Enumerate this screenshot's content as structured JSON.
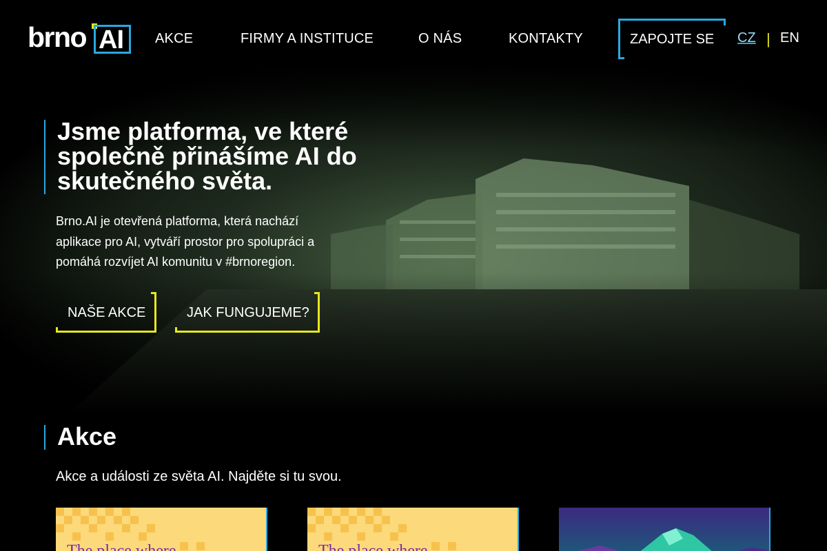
{
  "header": {
    "logo": {
      "text": "brno",
      "boxed_text": "AI",
      "alt": "brno.AI"
    },
    "nav": [
      {
        "label": "AKCE"
      },
      {
        "label": "FIRMY A INSTITUCE"
      },
      {
        "label": "O NÁS"
      },
      {
        "label": "KONTAKTY"
      }
    ],
    "cta_label": "ZAPOJTE SE",
    "languages": [
      {
        "label": "CZ",
        "active": true
      },
      {
        "label": "EN",
        "active": false
      }
    ],
    "lang_separator": "|"
  },
  "hero": {
    "title": "Jsme platforma, ve které společně přinášíme AI do skutečného světa.",
    "lead": "Brno.AI je otevřená platforma, která nachází aplikace pro AI, vytváří prostor pro spolupráci a pomáhá rozvíjet AI komunitu v #brnoregion.",
    "buttons": [
      {
        "label": "NAŠE AKCE"
      },
      {
        "label": "JAK FUNGUJEME?"
      }
    ]
  },
  "events": {
    "title": "Akce",
    "subtitle": "Akce a události ze světa AI. Najděte si tu svou.",
    "cards": [
      {
        "title": "The place where"
      },
      {
        "title": "The place where"
      },
      {
        "title": ""
      }
    ]
  },
  "colors": {
    "accent_blue": "#29a9e1",
    "accent_yellow": "#e6e81e",
    "background": "#000000",
    "card_yellow": "#fcd97a"
  }
}
